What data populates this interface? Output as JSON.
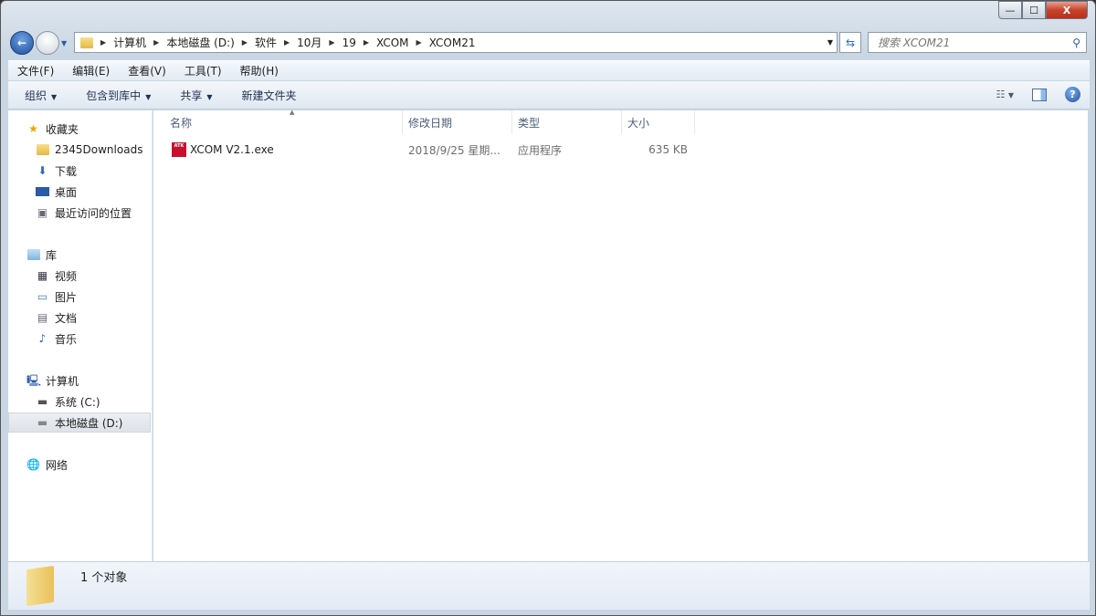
{
  "window": {
    "controls": {
      "minimize": "—",
      "maximize": "☐",
      "close": "X"
    }
  },
  "address": {
    "crumbs": [
      "计算机",
      "本地磁盘 (D:)",
      "软件",
      "10月",
      "19",
      "XCOM",
      "XCOM21"
    ]
  },
  "search": {
    "placeholder": "搜索 XCOM21"
  },
  "menu": [
    "文件(F)",
    "编辑(E)",
    "查看(V)",
    "工具(T)",
    "帮助(H)"
  ],
  "toolbar": {
    "organize": "组织",
    "include_library": "包含到库中",
    "share": "共享",
    "new_folder": "新建文件夹"
  },
  "sidebar": {
    "favorites": {
      "label": "收藏夹",
      "items": [
        "2345Downloads",
        "下载",
        "桌面",
        "最近访问的位置"
      ]
    },
    "libraries": {
      "label": "库",
      "items": [
        "视频",
        "图片",
        "文档",
        "音乐"
      ]
    },
    "computer": {
      "label": "计算机",
      "items": [
        "系统 (C:)",
        "本地磁盘 (D:)"
      ],
      "selected": "本地磁盘 (D:)"
    },
    "network": {
      "label": "网络"
    }
  },
  "columns": [
    "名称",
    "修改日期",
    "类型",
    "大小"
  ],
  "files": [
    {
      "name": "XCOM V2.1.exe",
      "modified": "2018/9/25 星期...",
      "type": "应用程序",
      "size": "635 KB",
      "icon_text": "ATK"
    }
  ],
  "status": {
    "count": "1 个对象"
  }
}
